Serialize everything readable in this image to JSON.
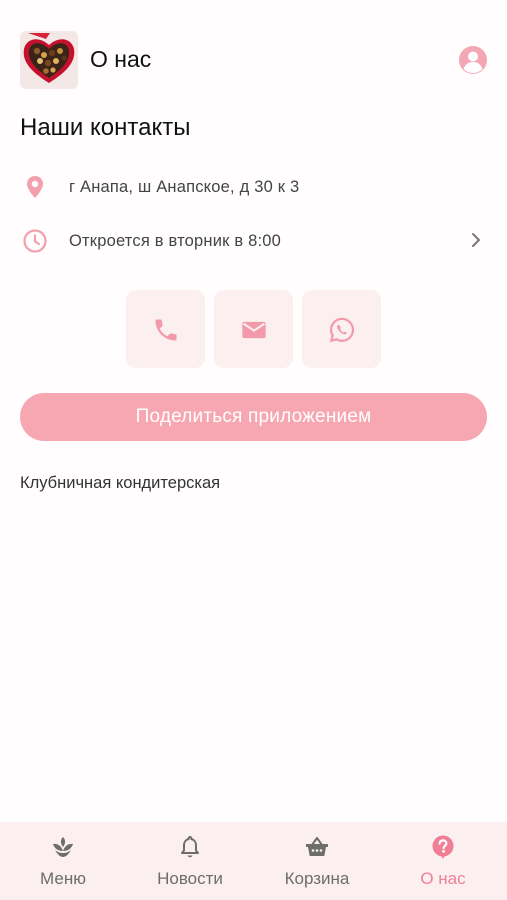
{
  "header": {
    "title": "О нас",
    "logo_icon": "chocolate-heart-box-logo",
    "profile_icon": "user-circle-icon"
  },
  "contacts": {
    "title": "Наши контакты",
    "address": "г Анапа, ш Анапское, д 30 к 3",
    "hours": "Откроется в вторник в 8:00",
    "address_icon": "map-pin-icon",
    "hours_icon": "clock-icon"
  },
  "actions": {
    "phone_icon": "phone-icon",
    "mail_icon": "mail-icon",
    "whatsapp_icon": "whatsapp-icon"
  },
  "share_button": "Поделиться приложением",
  "description": "Клубничная кондитерская",
  "tabs": [
    {
      "label": "Меню",
      "icon": "flower-icon",
      "active": false
    },
    {
      "label": "Новости",
      "icon": "bell-icon",
      "active": false
    },
    {
      "label": "Корзина",
      "icon": "basket-icon",
      "active": false
    },
    {
      "label": "О нас",
      "icon": "question-circle-icon",
      "active": true
    }
  ],
  "colors": {
    "accent": "#f07f96",
    "button": "#f7a7b2",
    "tile": "#fcefef",
    "tabbar": "#fbefef"
  }
}
